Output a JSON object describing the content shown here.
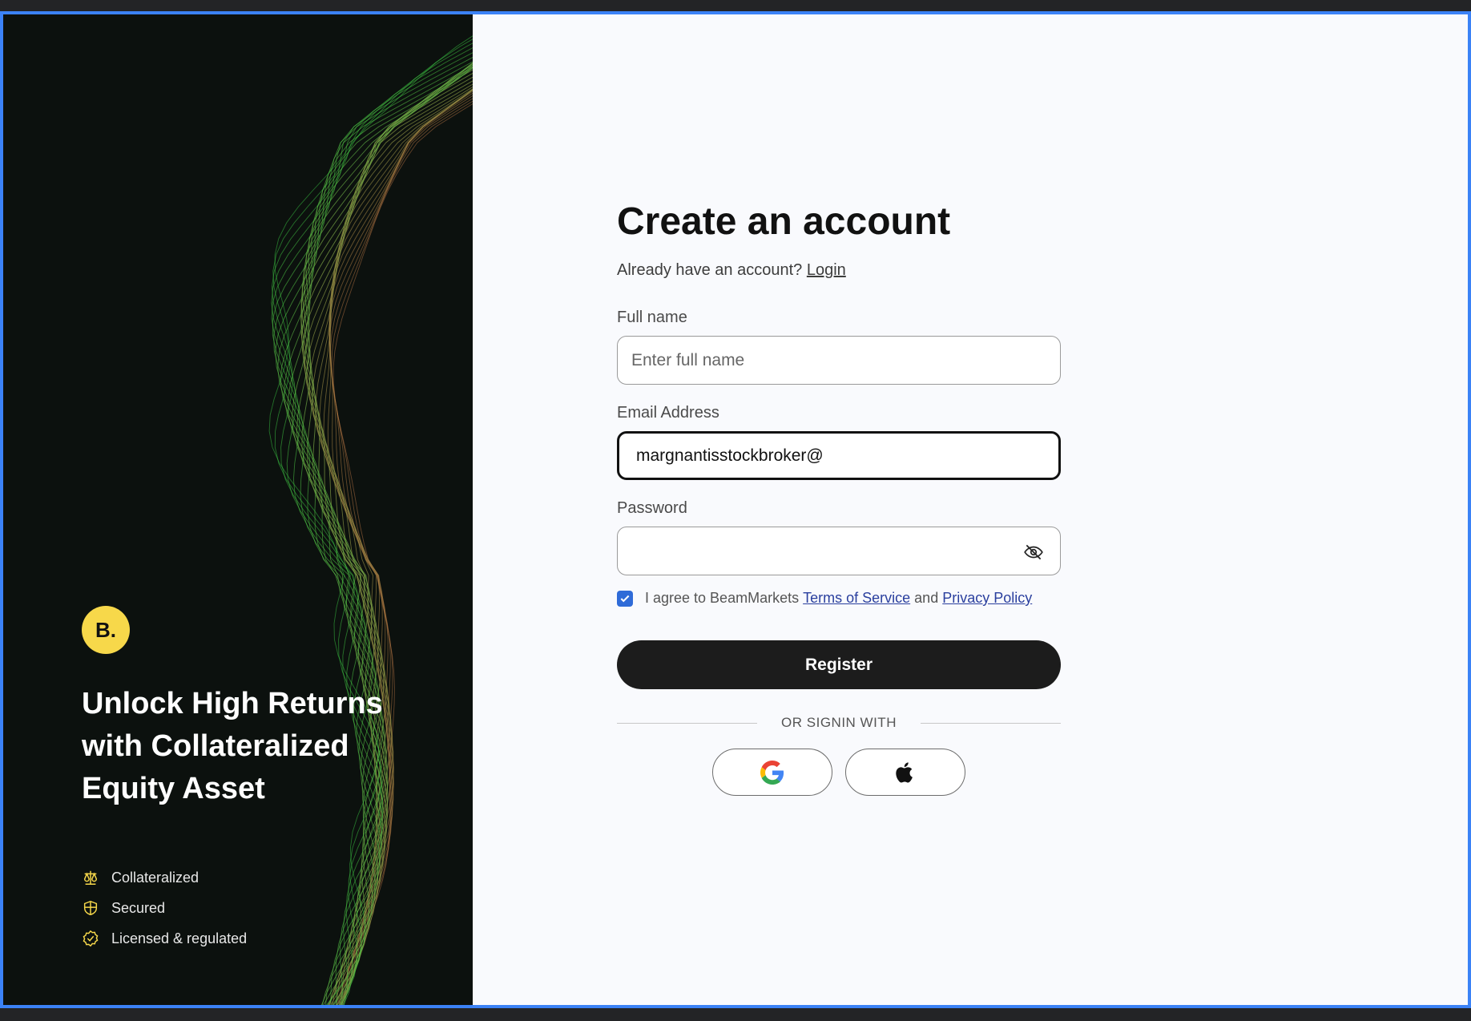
{
  "hero": {
    "logo_text": "B.",
    "headline": "Unlock High Returns with Collateralized Equity Asset",
    "features": [
      {
        "icon": "scale-icon",
        "label": "Collateralized"
      },
      {
        "icon": "shield-icon",
        "label": "Secured"
      },
      {
        "icon": "badge-check-icon",
        "label": "Licensed & regulated"
      }
    ],
    "accent_color": "#f7d84a"
  },
  "form": {
    "title": "Create an account",
    "login_prompt": "Already have an account?",
    "login_link": "Login",
    "full_name_label": "Full name",
    "full_name_placeholder": "Enter full name",
    "email_label": "Email Address",
    "email_value": "margnantisstockbroker@",
    "password_label": "Password",
    "password_value": "",
    "agree_prefix": "I agree to BeamMarkets",
    "terms_link": "Terms of Service",
    "agree_and": "and",
    "privacy_link": "Privacy Policy",
    "agree_checked": true,
    "register_label": "Register",
    "divider_text": "OR SIGNIN WITH",
    "social": [
      "google-icon",
      "apple-icon"
    ]
  }
}
